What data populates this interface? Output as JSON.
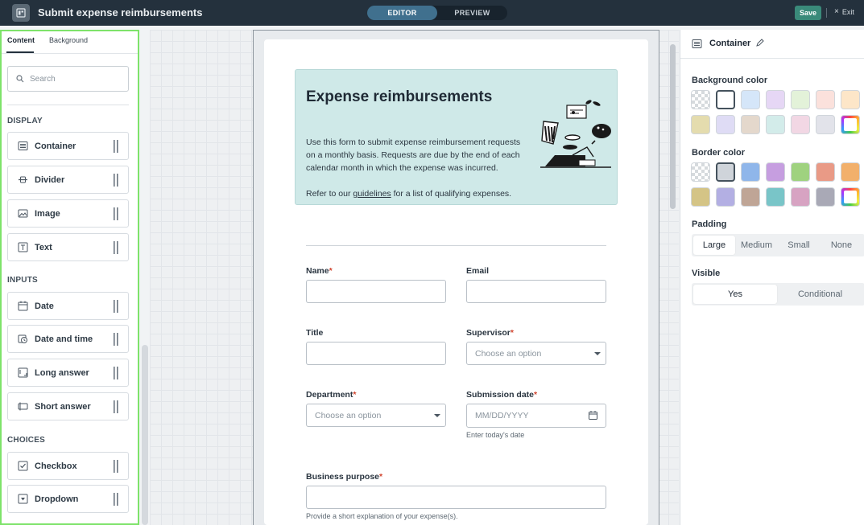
{
  "topbar": {
    "title": "Submit expense reimbursements",
    "modes": [
      "EDITOR",
      "PREVIEW"
    ],
    "active_mode": "EDITOR",
    "save_label": "Save",
    "exit_label": "Exit"
  },
  "left_panel": {
    "tabs": [
      "Content",
      "Background"
    ],
    "active_tab": "Content",
    "search_placeholder": "Search",
    "sections": {
      "display": "DISPLAY",
      "inputs": "INPUTS",
      "choices": "CHOICES"
    },
    "display_items": [
      "Container",
      "Divider",
      "Image",
      "Text"
    ],
    "input_items": [
      "Date",
      "Date and time",
      "Long answer",
      "Short answer"
    ],
    "choice_items": [
      "Checkbox",
      "Dropdown"
    ]
  },
  "form": {
    "banner_title": "Expense reimbursements",
    "banner_desc": "Use this form to submit expense reimbursement requests on a monthly basis. Requests are due by the end of each calendar month in which the expense was incurred.",
    "banner_ref_prefix": "Refer to our ",
    "banner_ref_link": "guidelines",
    "banner_ref_suffix": " for a list of qualifying expenses.",
    "fields": {
      "name": "Name",
      "email": "Email",
      "title": "Title",
      "supervisor": "Supervisor",
      "department": "Department",
      "submission_date": "Submission date",
      "business_purpose": "Business purpose"
    },
    "required_mark": "*",
    "supervisor_placeholder": "Choose an option",
    "department_placeholder": "Choose an option",
    "date_placeholder": "MM/DD/YYYY",
    "date_hint": "Enter today's date",
    "purpose_hint": "Provide a short explanation of your expense(s)."
  },
  "right_panel": {
    "title": "Container",
    "background_color_label": "Background color",
    "border_color_label": "Border color",
    "padding_label": "Padding",
    "padding_options": [
      "Large",
      "Medium",
      "Small",
      "None"
    ],
    "padding_selected": "Large",
    "visible_label": "Visible",
    "visible_options": [
      "Yes",
      "Conditional"
    ],
    "visible_selected": "Yes",
    "background_swatches": [
      "transparent",
      "#ffffff",
      "#d5e6f9",
      "#e6d7f5",
      "#e3f2d9",
      "#fbe1dc",
      "#fde6c8",
      "#e4dcae",
      "#dfdcf5",
      "#e4d8cc",
      "#d3ecea",
      "#f2d7e4",
      "#e2e3ea",
      "rainbow"
    ],
    "background_selected": 1,
    "border_swatches": [
      "transparent",
      "#cfd4da",
      "#8fb6ea",
      "#c69ee0",
      "#9fd27f",
      "#e99a86",
      "#f2b06b",
      "#d4c486",
      "#b3afe3",
      "#bfa596",
      "#79c5c8",
      "#d7a3c2",
      "#a9a9b6",
      "rainbow"
    ],
    "border_selected": 1
  },
  "colors": {
    "topbar": "#24313d",
    "accent_save": "#3a8a7a",
    "banner_bg": "#cfe9e8",
    "required": "#d2452f",
    "panel_highlight": "#7ee36a"
  }
}
